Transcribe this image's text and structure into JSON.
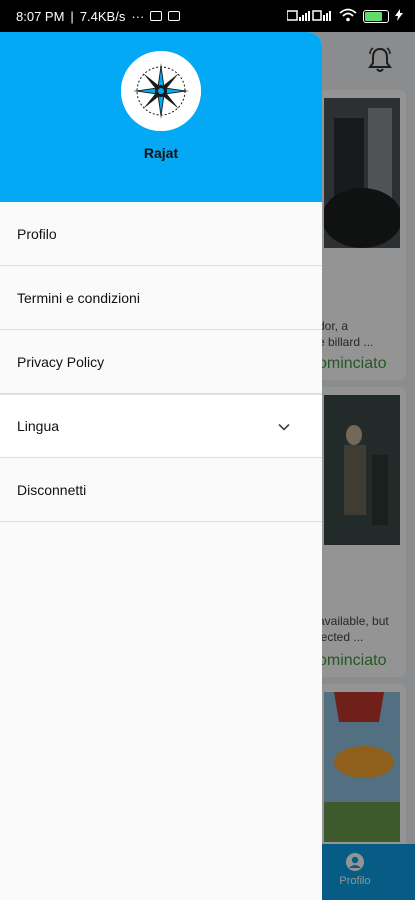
{
  "status_bar": {
    "time": "8:07 PM",
    "speed": "7.4KB/s",
    "extra": "···"
  },
  "drawer": {
    "username": "Rajat",
    "items": [
      {
        "label": "Profilo"
      },
      {
        "label": "Termini e condizioni"
      },
      {
        "label": "Privacy Policy"
      },
      {
        "label": "Lingua"
      },
      {
        "label": "Disconnetti"
      }
    ]
  },
  "background": {
    "cards": [
      {
        "line1": "dor, a",
        "line2": "e billard ...",
        "status": "ominciato"
      },
      {
        "line1": "available, but",
        "line2": "jected ...",
        "status": "ominciato"
      },
      {
        "line1": "",
        "line2": "",
        "status": ""
      }
    ],
    "bottom_tab_label": "Profilo"
  },
  "colors": {
    "header": "#03a9f4",
    "status_green": "#3e9a3e",
    "nav_blue": "#0b9fe3"
  }
}
